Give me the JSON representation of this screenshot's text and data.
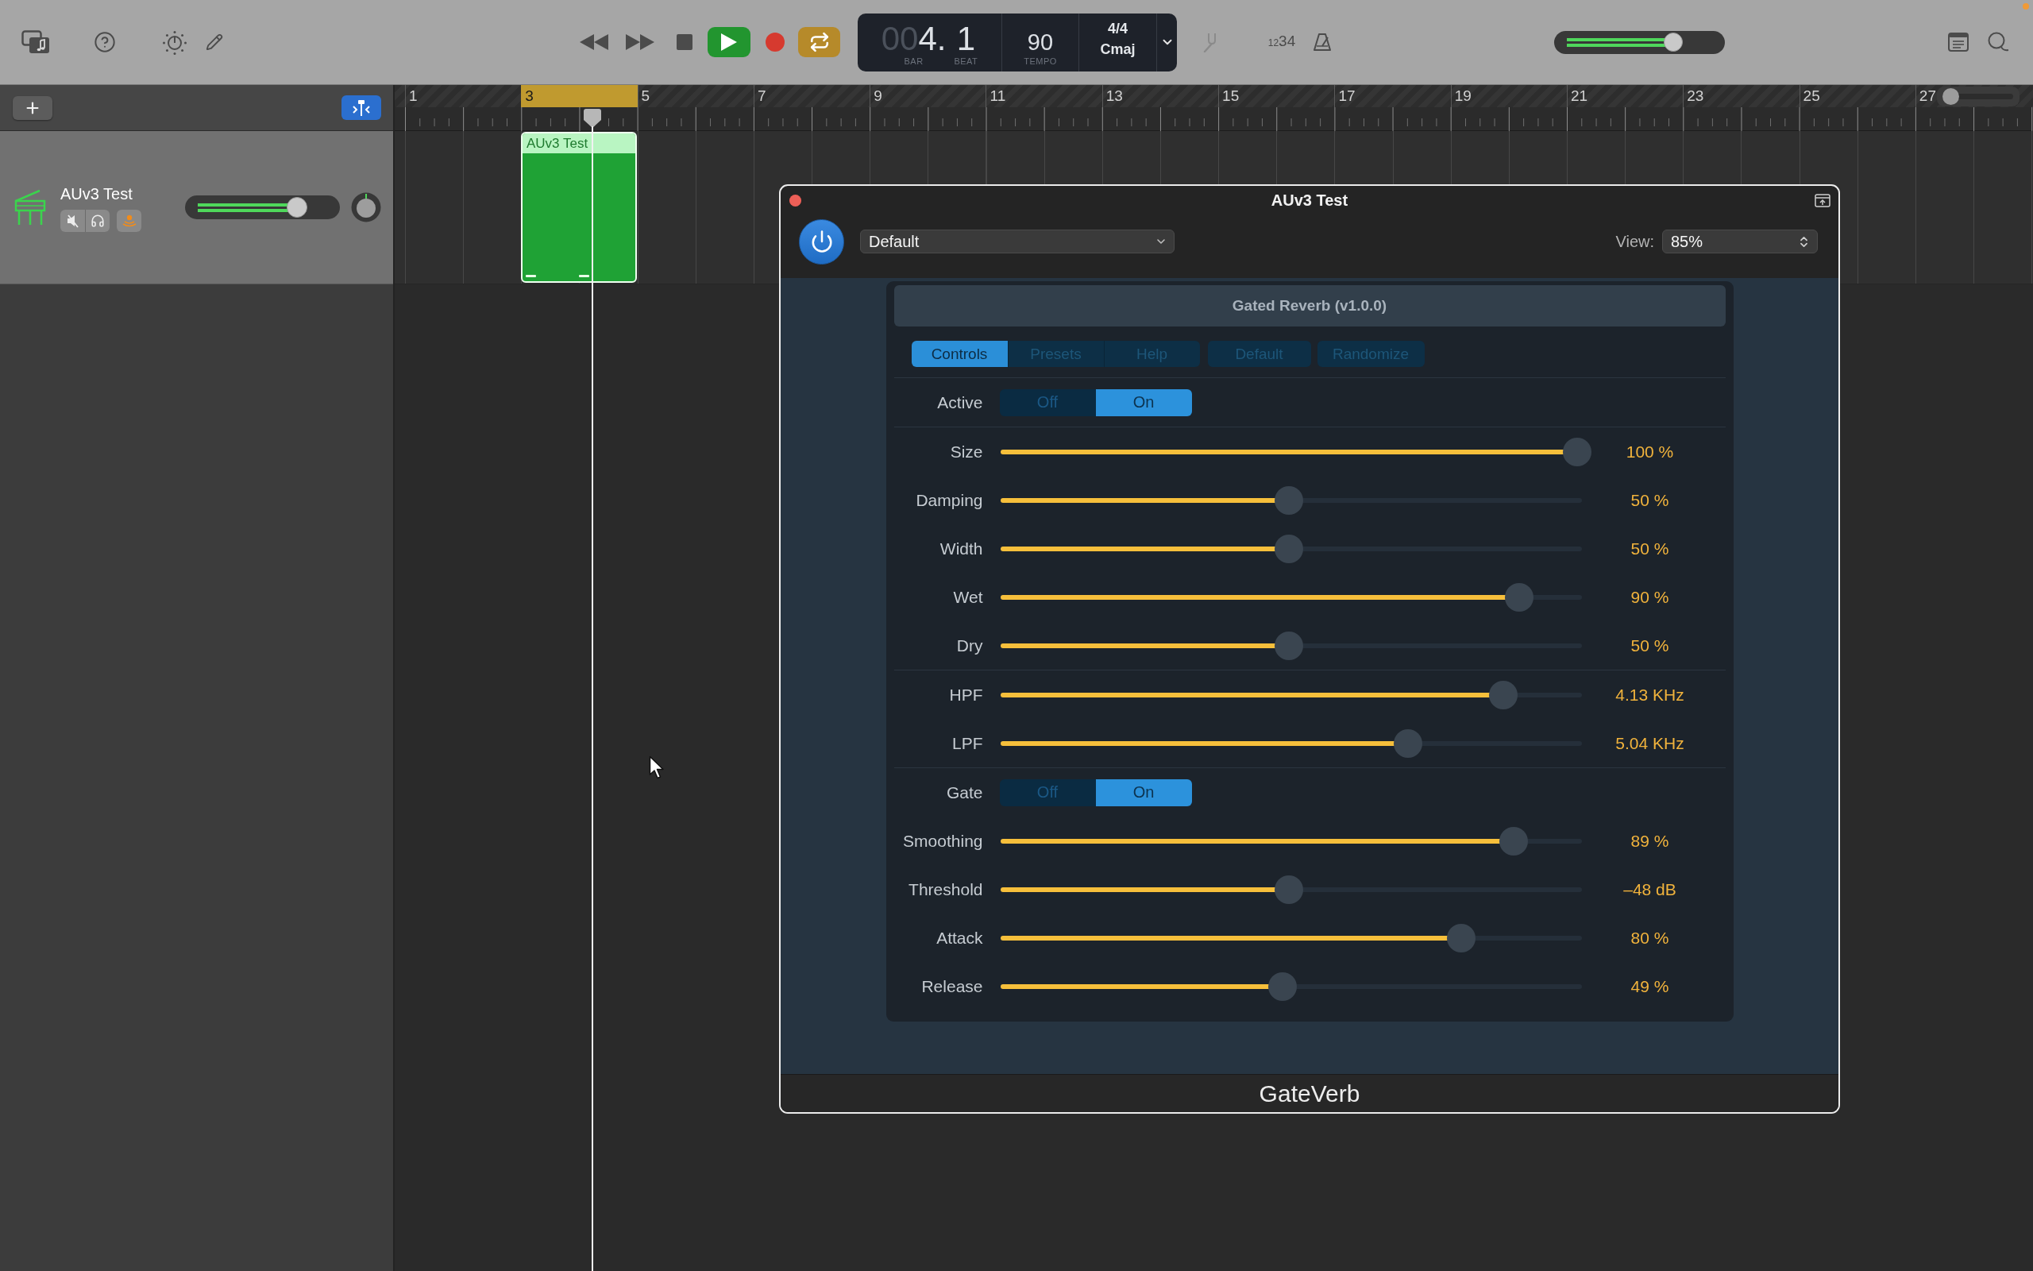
{
  "toolbar": {
    "transport": {
      "playing": true,
      "cycle": true
    },
    "lcd": {
      "bar_dim": "00",
      "bar": "4.",
      "bar_label": "BAR",
      "beat": "1",
      "beat_label": "BEAT",
      "tempo": "90",
      "tempo_label": "TEMPO",
      "signature": "4/4",
      "key": "Cmaj"
    },
    "count_in": "1234",
    "master_volume": {
      "level": 0.72
    }
  },
  "tracks": [
    {
      "name": "AUv3 Test",
      "monitoring": {
        "on": true
      },
      "volume": {
        "level": 0.76
      }
    }
  ],
  "ruler": {
    "bars": [
      {
        "label": "1",
        "cycle": false
      },
      {
        "label": "3",
        "cycle": true
      },
      {
        "label": "5",
        "cycle": false
      },
      {
        "label": "7",
        "cycle": false
      },
      {
        "label": "9",
        "cycle": false
      },
      {
        "label": "11",
        "cycle": false
      },
      {
        "label": "13",
        "cycle": false
      },
      {
        "label": "15",
        "cycle": false
      },
      {
        "label": "17",
        "cycle": false
      },
      {
        "label": "19",
        "cycle": false
      },
      {
        "label": "21",
        "cycle": false
      },
      {
        "label": "23",
        "cycle": false
      },
      {
        "label": "25",
        "cycle": false
      },
      {
        "label": "27",
        "cycle": false
      }
    ],
    "zoom_slider": {
      "level": 0.05
    }
  },
  "regions": [
    {
      "name": "AUv3 Test"
    }
  ],
  "plugin_window": {
    "title": "AUv3 Test",
    "power": {
      "on": true
    },
    "preset": "Default",
    "view_label": "View:",
    "view": "85%",
    "panel": {
      "title": "Gated Reverb (v1.0.0)",
      "tabs": [
        {
          "label": "Controls",
          "selected": true
        },
        {
          "label": "Presets",
          "selected": false
        },
        {
          "label": "Help",
          "selected": false
        }
      ],
      "actions": [
        "Default",
        "Randomize"
      ],
      "sections": [
        {
          "rows": [
            {
              "kind": "toggle",
              "label": "Active",
              "options": [
                {
                  "label": "Off",
                  "selected": false
                },
                {
                  "label": "On",
                  "selected": true
                }
              ]
            }
          ]
        },
        {
          "rows": [
            {
              "kind": "slider",
              "label": "Size",
              "level": 1.0,
              "reading": "100 %"
            },
            {
              "kind": "slider",
              "label": "Damping",
              "level": 0.5,
              "reading": "50 %"
            },
            {
              "kind": "slider",
              "label": "Width",
              "level": 0.5,
              "reading": "50 %"
            },
            {
              "kind": "slider",
              "label": "Wet",
              "level": 0.9,
              "reading": "90 %"
            },
            {
              "kind": "slider",
              "label": "Dry",
              "level": 0.5,
              "reading": "50 %"
            }
          ]
        },
        {
          "rows": [
            {
              "kind": "slider",
              "label": "HPF",
              "level": 0.872,
              "reading": "4.13 KHz"
            },
            {
              "kind": "slider",
              "label": "LPF",
              "level": 0.707,
              "reading": "5.04 KHz"
            }
          ]
        },
        {
          "rows": [
            {
              "kind": "toggle",
              "label": "Gate",
              "options": [
                {
                  "label": "Off",
                  "selected": false
                },
                {
                  "label": "On",
                  "selected": true
                }
              ]
            },
            {
              "kind": "slider",
              "label": "Smoothing",
              "level": 0.89,
              "reading": "89 %"
            },
            {
              "kind": "slider",
              "label": "Threshold",
              "level": 0.5,
              "reading": "–48 dB"
            },
            {
              "kind": "slider",
              "label": "Attack",
              "level": 0.8,
              "reading": "80 %"
            },
            {
              "kind": "slider",
              "label": "Release",
              "level": 0.49,
              "reading": "49 %"
            }
          ]
        }
      ]
    },
    "footer": "GateVerb"
  }
}
